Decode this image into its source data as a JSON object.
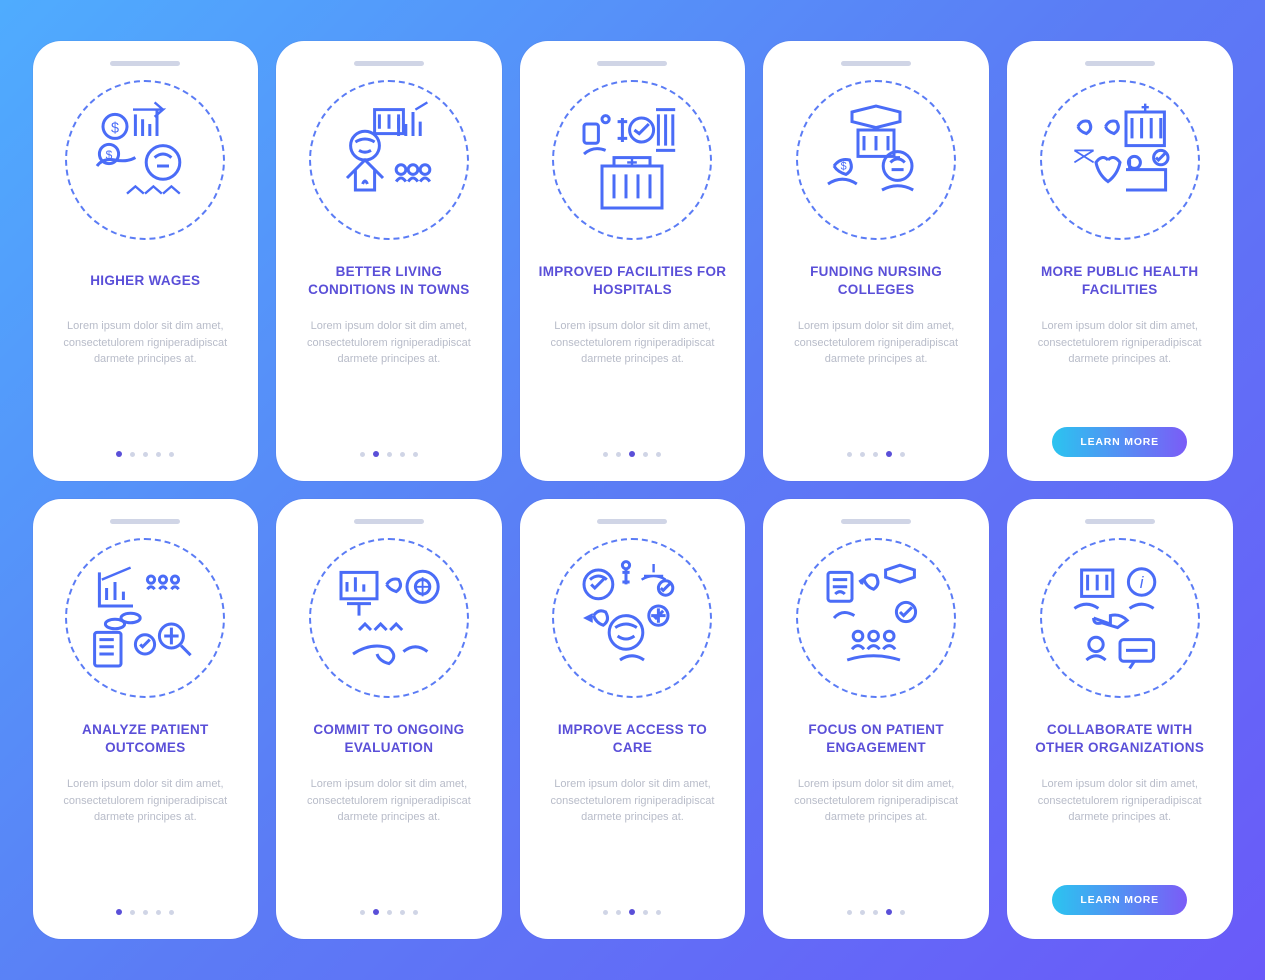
{
  "lorem": "Lorem ipsum dolor sit dim amet, consectetulorem rigniperadipiscat darmete principes at.",
  "learn_more": "LEARN MORE",
  "cards": [
    {
      "title": "HIGHER WAGES",
      "icon": "wages",
      "active_dot": 0,
      "has_button": false
    },
    {
      "title": "BETTER LIVING CONDITIONS IN TOWNS",
      "icon": "town",
      "active_dot": 1,
      "has_button": false
    },
    {
      "title": "IMPROVED FACILITIES FOR HOSPITALS",
      "icon": "hospital",
      "active_dot": 2,
      "has_button": false
    },
    {
      "title": "FUNDING NURSING COLLEGES",
      "icon": "nursing",
      "active_dot": 3,
      "has_button": false
    },
    {
      "title": "MORE PUBLIC HEALTH FACILITIES",
      "icon": "public-health",
      "active_dot": -1,
      "has_button": true
    },
    {
      "title": "ANALYZE PATIENT OUTCOMES",
      "icon": "analyze",
      "active_dot": 0,
      "has_button": false
    },
    {
      "title": "COMMIT TO ONGOING EVALUATION",
      "icon": "evaluation",
      "active_dot": 1,
      "has_button": false
    },
    {
      "title": "IMPROVE ACCESS TO CARE",
      "icon": "access",
      "active_dot": 2,
      "has_button": false
    },
    {
      "title": "FOCUS ON PATIENT ENGAGEMENT",
      "icon": "engagement",
      "active_dot": 3,
      "has_button": false
    },
    {
      "title": "COLLABORATE WITH OTHER ORGANIZATIONS",
      "icon": "collaborate",
      "active_dot": -1,
      "has_button": true
    }
  ]
}
